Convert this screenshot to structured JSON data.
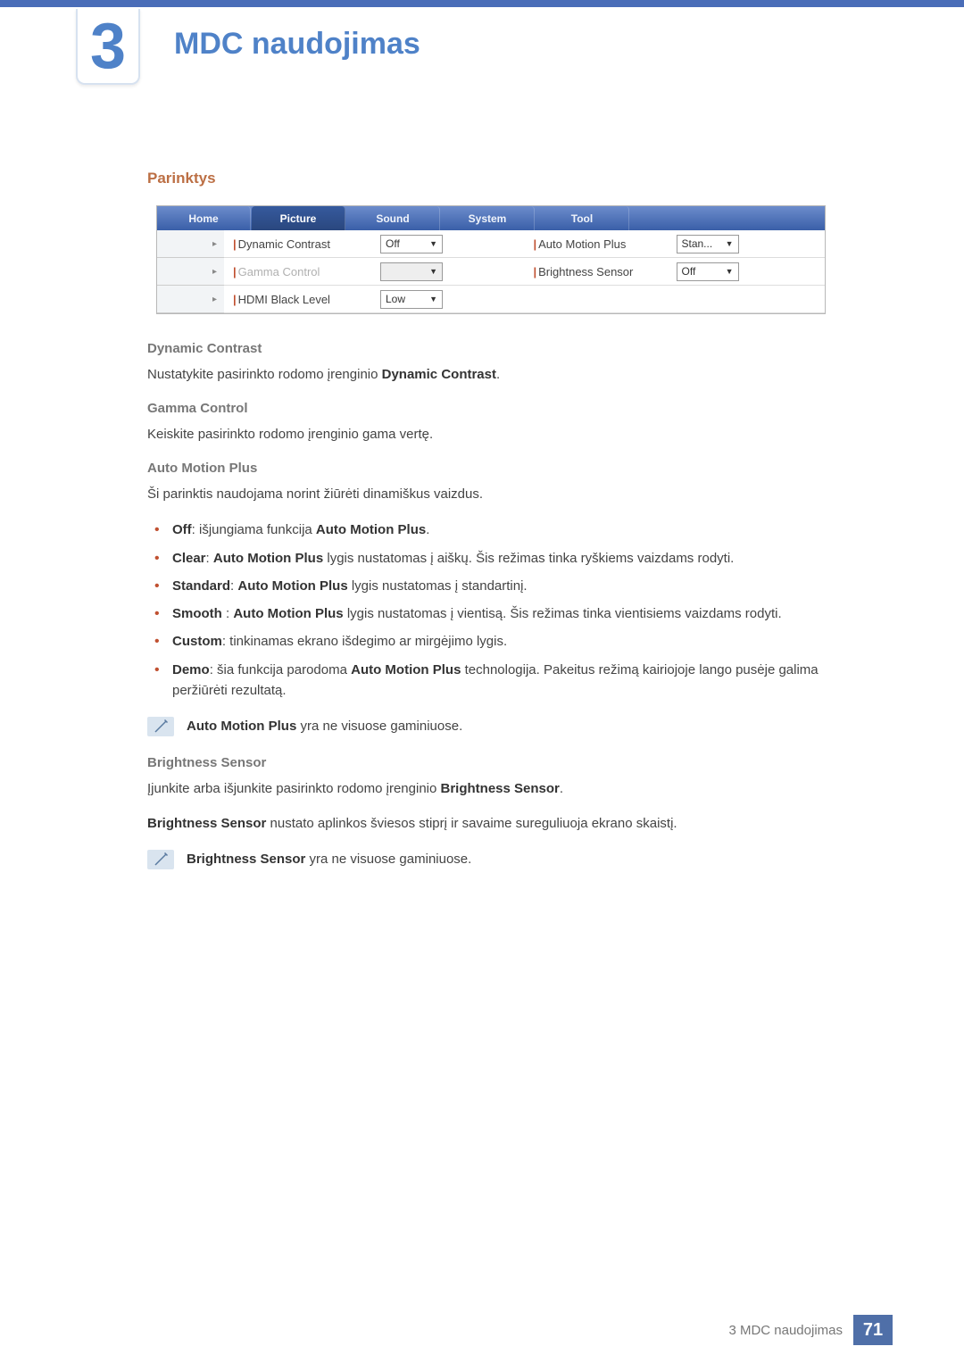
{
  "chapter": {
    "number": "3",
    "title": "MDC naudojimas"
  },
  "section": {
    "title": "Parinktys"
  },
  "ui": {
    "tabs": [
      "Home",
      "Picture",
      "Sound",
      "System",
      "Tool"
    ],
    "active_tab_index": 1,
    "left": [
      {
        "label": "Dynamic Contrast",
        "value": "Off",
        "disabled": false
      },
      {
        "label": "Gamma Control",
        "value": "",
        "disabled": true
      },
      {
        "label": "HDMI Black Level",
        "value": "Low",
        "disabled": false
      }
    ],
    "right": [
      {
        "label": "Auto Motion Plus",
        "value": "Stan...",
        "disabled": false
      },
      {
        "label": "Brightness Sensor",
        "value": "Off",
        "disabled": false
      }
    ]
  },
  "dc": {
    "head": "Dynamic Contrast",
    "text_pre": "Nustatykite pasirinkto rodomo įrenginio ",
    "text_bold": "Dynamic Contrast",
    "text_post": "."
  },
  "gc": {
    "head": "Gamma Control",
    "text": "Keiskite pasirinkto rodomo įrenginio gama vertę."
  },
  "amp": {
    "head": "Auto Motion Plus",
    "intro": "Ši parinktis naudojama norint žiūrėti dinamiškus vaizdus.",
    "items": [
      {
        "b1": "Off",
        "t1": ": išjungiama funkcija ",
        "b2": "Auto Motion Plus",
        "t2": "."
      },
      {
        "b1": "Clear",
        "t1": ": ",
        "b2": "Auto Motion Plus",
        "t2": " lygis nustatomas į aiškų. Šis režimas tinka ryškiems vaizdams rodyti."
      },
      {
        "b1": "Standard",
        "t1": ": ",
        "b2": "Auto Motion Plus",
        "t2": " lygis nustatomas į standartinį."
      },
      {
        "b1": "Smooth",
        "t1": " : ",
        "b2": "Auto Motion Plus",
        "t2": " lygis nustatomas į vientisą. Šis režimas tinka vientisiems vaizdams rodyti."
      },
      {
        "b1": "Custom",
        "t1": ": tinkinamas ekrano išdegimo ar mirgėjimo lygis.",
        "b2": "",
        "t2": ""
      },
      {
        "b1": "Demo",
        "t1": ": šia funkcija parodoma ",
        "b2": "Auto Motion Plus",
        "t2": " technologija. Pakeitus režimą kairiojoje lango pusėje galima peržiūrėti rezultatą."
      }
    ],
    "note_bold": "Auto Motion Plus",
    "note_text": " yra ne visuose gaminiuose."
  },
  "bs": {
    "head": "Brightness Sensor",
    "p1_pre": "Įjunkite arba išjunkite pasirinkto rodomo įrenginio ",
    "p1_bold": "Brightness Sensor",
    "p1_post": ".",
    "p2_bold": "Brightness Sensor",
    "p2_text": " nustato aplinkos šviesos stiprį ir savaime sureguliuoja ekrano skaistį.",
    "note_bold": "Brightness Sensor",
    "note_text": " yra ne visuose gaminiuose."
  },
  "footer": {
    "text": "3 MDC naudojimas",
    "page": "71"
  }
}
